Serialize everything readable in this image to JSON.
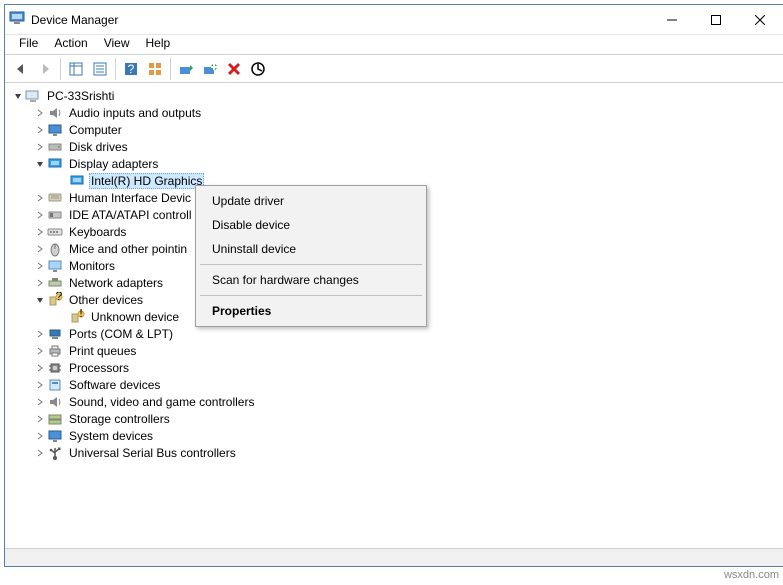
{
  "window": {
    "title": "Device Manager",
    "watermark": "wsxdn.com"
  },
  "menus": {
    "file": "File",
    "action": "Action",
    "view": "View",
    "help": "Help"
  },
  "tree": {
    "root": "PC-33Srishti",
    "audio": "Audio inputs and outputs",
    "computer": "Computer",
    "disk": "Disk drives",
    "display": "Display adapters",
    "display_child": "Intel(R) HD Graphics",
    "hid": "Human Interface Devic",
    "ide": "IDE ATA/ATAPI controll",
    "keyboards": "Keyboards",
    "mice": "Mice and other pointin",
    "monitors": "Monitors",
    "network": "Network adapters",
    "other": "Other devices",
    "other_child": "Unknown device",
    "ports": "Ports (COM & LPT)",
    "printq": "Print queues",
    "processors": "Processors",
    "softdev": "Software devices",
    "sound": "Sound, video and game controllers",
    "storage": "Storage controllers",
    "sysdev": "System devices",
    "usb": "Universal Serial Bus controllers"
  },
  "context": {
    "update": "Update driver",
    "disable": "Disable device",
    "uninstall": "Uninstall device",
    "scan": "Scan for hardware changes",
    "properties": "Properties"
  }
}
